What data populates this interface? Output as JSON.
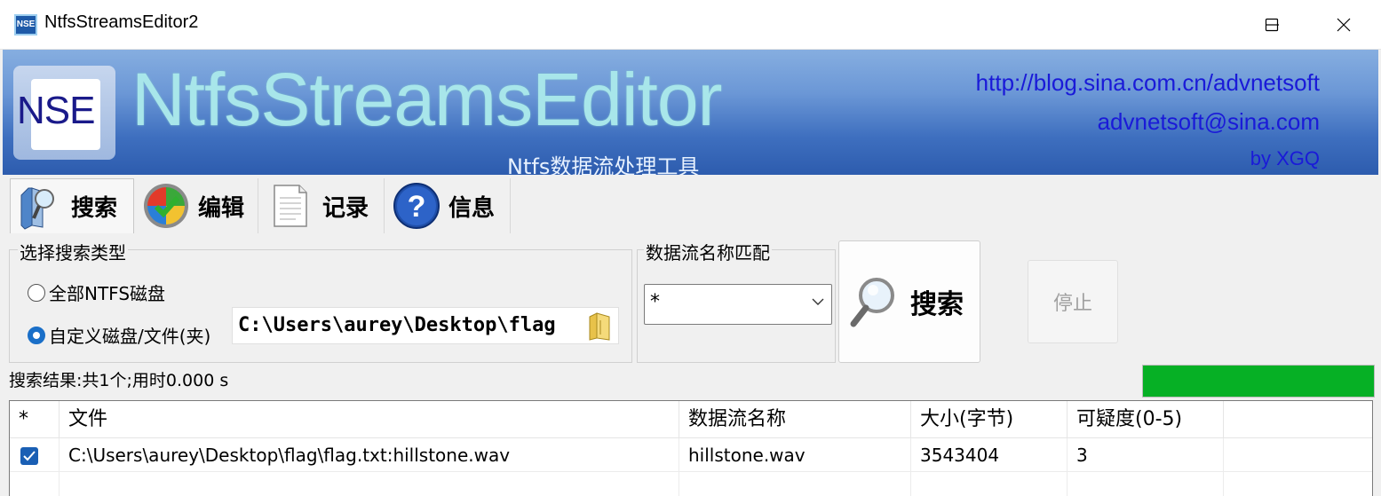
{
  "window": {
    "title": "NtfsStreamsEditor2",
    "icon_text": "NSE"
  },
  "banner": {
    "logo_text": "NSE",
    "brand": "NtfsStreamsEditor",
    "subtitle": "Ntfs数据流处理工具",
    "url": "http://blog.sina.com.cn/advnetsoft",
    "email": "advnetsoft@sina.com",
    "byline": "by XGQ"
  },
  "tabs": [
    {
      "label": "搜索",
      "icon": "search-folder-icon"
    },
    {
      "label": "编辑",
      "icon": "shield-check-icon"
    },
    {
      "label": "记录",
      "icon": "notepad-icon"
    },
    {
      "label": "信息",
      "icon": "help-icon"
    }
  ],
  "search_type": {
    "legend": "选择搜索类型",
    "option_all": "全部NTFS磁盘",
    "option_custom": "自定义磁盘/文件(夹)",
    "selected": "custom",
    "path": "C:\\Users\\aurey\\Desktop\\flag"
  },
  "stream_match": {
    "legend": "数据流名称匹配",
    "value": "*"
  },
  "buttons": {
    "search": "搜索",
    "stop": "停止"
  },
  "status": {
    "text": "搜索结果:共1个;用时0.000 s",
    "progress": 1.0
  },
  "colors": {
    "progress": "#06b025",
    "link": "#1a1ad8",
    "brand": "#a8e6ea"
  },
  "table": {
    "columns": [
      "*",
      "文件",
      "数据流名称",
      "大小(字节)",
      "可疑度(0-5)"
    ],
    "rows": [
      {
        "checked": true,
        "file": "C:\\Users\\aurey\\Desktop\\flag\\flag.txt:hillstone.wav",
        "stream": "hillstone.wav",
        "size": "3543404",
        "suspicion": "3"
      }
    ]
  }
}
